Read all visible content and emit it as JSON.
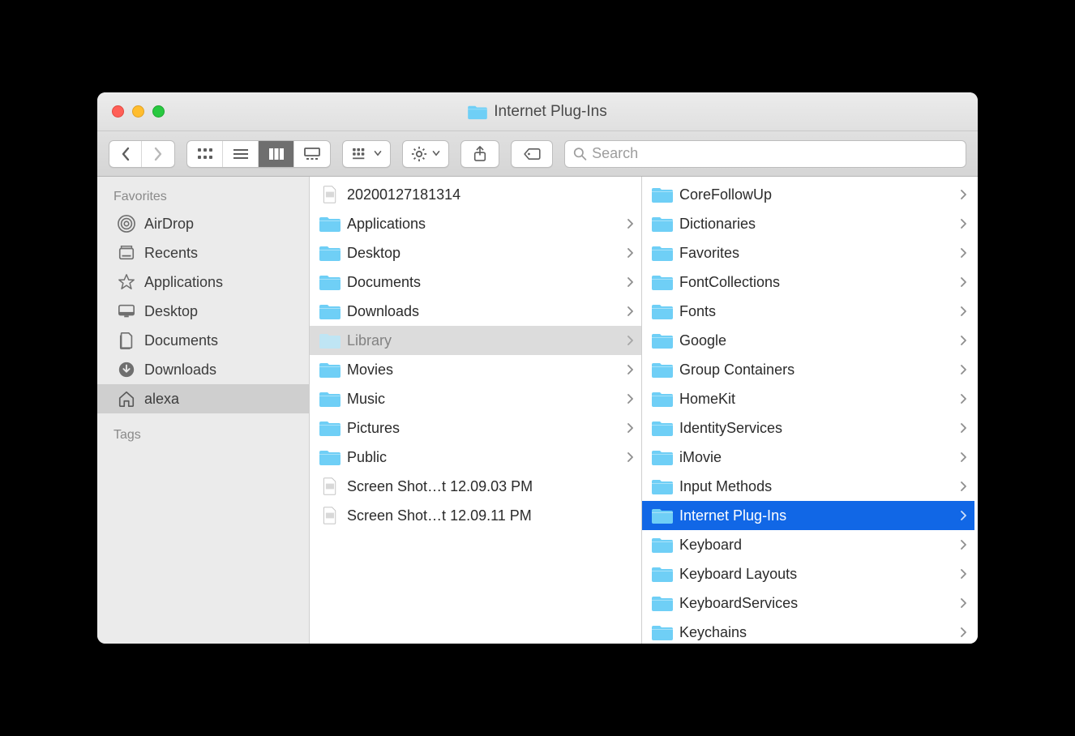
{
  "window": {
    "title": "Internet Plug-Ins"
  },
  "search": {
    "placeholder": "Search"
  },
  "sidebar": {
    "favorites_header": "Favorites",
    "tags_header": "Tags",
    "items": [
      {
        "label": "AirDrop",
        "icon": "airdrop",
        "selected": false
      },
      {
        "label": "Recents",
        "icon": "recents",
        "selected": false
      },
      {
        "label": "Applications",
        "icon": "applications",
        "selected": false
      },
      {
        "label": "Desktop",
        "icon": "desktop",
        "selected": false
      },
      {
        "label": "Documents",
        "icon": "documents",
        "selected": false
      },
      {
        "label": "Downloads",
        "icon": "downloads",
        "selected": false
      },
      {
        "label": "alexa",
        "icon": "home",
        "selected": true
      }
    ]
  },
  "columns": [
    {
      "id": "col1",
      "items": [
        {
          "name": "20200127181314",
          "type": "file-image",
          "folder": false,
          "selected": ""
        },
        {
          "name": "Applications",
          "type": "folder",
          "folder": true,
          "selected": ""
        },
        {
          "name": "Desktop",
          "type": "folder",
          "folder": true,
          "selected": ""
        },
        {
          "name": "Documents",
          "type": "folder",
          "folder": true,
          "selected": ""
        },
        {
          "name": "Downloads",
          "type": "folder",
          "folder": true,
          "selected": ""
        },
        {
          "name": "Library",
          "type": "folder",
          "folder": true,
          "selected": "light"
        },
        {
          "name": "Movies",
          "type": "folder",
          "folder": true,
          "selected": ""
        },
        {
          "name": "Music",
          "type": "folder",
          "folder": true,
          "selected": ""
        },
        {
          "name": "Pictures",
          "type": "folder",
          "folder": true,
          "selected": ""
        },
        {
          "name": "Public",
          "type": "folder",
          "folder": true,
          "selected": ""
        },
        {
          "name": "Screen Shot…t 12.09.03 PM",
          "type": "file-png",
          "folder": false,
          "selected": ""
        },
        {
          "name": "Screen Shot…t 12.09.11 PM",
          "type": "file-png",
          "folder": false,
          "selected": ""
        }
      ]
    },
    {
      "id": "col2",
      "items": [
        {
          "name": "CoreFollowUp",
          "type": "folder",
          "folder": true,
          "selected": ""
        },
        {
          "name": "Dictionaries",
          "type": "folder",
          "folder": true,
          "selected": ""
        },
        {
          "name": "Favorites",
          "type": "folder",
          "folder": true,
          "selected": ""
        },
        {
          "name": "FontCollections",
          "type": "folder",
          "folder": true,
          "selected": ""
        },
        {
          "name": "Fonts",
          "type": "folder",
          "folder": true,
          "selected": ""
        },
        {
          "name": "Google",
          "type": "folder",
          "folder": true,
          "selected": ""
        },
        {
          "name": "Group Containers",
          "type": "folder",
          "folder": true,
          "selected": ""
        },
        {
          "name": "HomeKit",
          "type": "folder",
          "folder": true,
          "selected": ""
        },
        {
          "name": "IdentityServices",
          "type": "folder",
          "folder": true,
          "selected": ""
        },
        {
          "name": "iMovie",
          "type": "folder",
          "folder": true,
          "selected": ""
        },
        {
          "name": "Input Methods",
          "type": "folder",
          "folder": true,
          "selected": ""
        },
        {
          "name": "Internet Plug-Ins",
          "type": "folder",
          "folder": true,
          "selected": "blue"
        },
        {
          "name": "Keyboard",
          "type": "folder",
          "folder": true,
          "selected": ""
        },
        {
          "name": "Keyboard Layouts",
          "type": "folder",
          "folder": true,
          "selected": ""
        },
        {
          "name": "KeyboardServices",
          "type": "folder",
          "folder": true,
          "selected": ""
        },
        {
          "name": "Keychains",
          "type": "folder",
          "folder": true,
          "selected": ""
        }
      ]
    }
  ],
  "colors": {
    "folder": "#6fcff6",
    "accent": "#1167e6"
  }
}
